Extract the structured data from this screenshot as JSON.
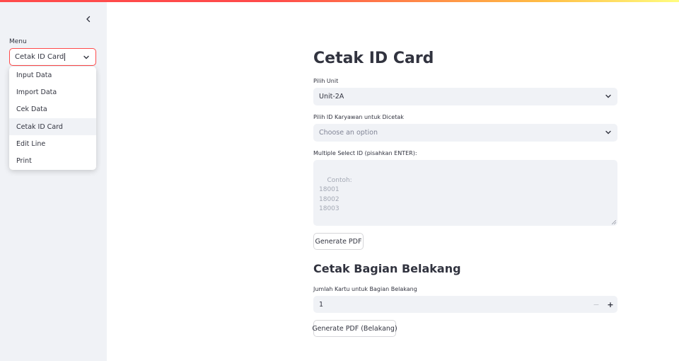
{
  "sidebar": {
    "menu_label": "Menu",
    "menu_value": "Cetak ID Card",
    "options": [
      {
        "label": "Input Data"
      },
      {
        "label": "Import Data"
      },
      {
        "label": "Cek Data"
      },
      {
        "label": "Cetak ID Card"
      },
      {
        "label": "Edit Line"
      },
      {
        "label": "Print"
      }
    ]
  },
  "main": {
    "title": "Cetak ID Card",
    "unit_label": "Pilih Unit",
    "unit_value": "Unit-2A",
    "employee_label": "Pilih ID Karyawan untuk Dicetak",
    "employee_placeholder": "Choose an option",
    "multi_label": "Multiple Select ID (pisahkan ENTER):",
    "multi_placeholder": "Contoh:\n18001\n18002\n18003",
    "generate_pdf": "Generate PDF",
    "back_title": "Cetak Bagian Belakang",
    "count_label": "Jumlah Kartu untuk Bagian Belakang",
    "count_value": "1",
    "minus_label": "−",
    "plus_label": "+",
    "generate_back": "Generate PDF (Belakang)"
  },
  "colors": {
    "accent": "#ff4b4b",
    "sidebar_bg": "#f0f2f6",
    "text": "#31333f"
  }
}
